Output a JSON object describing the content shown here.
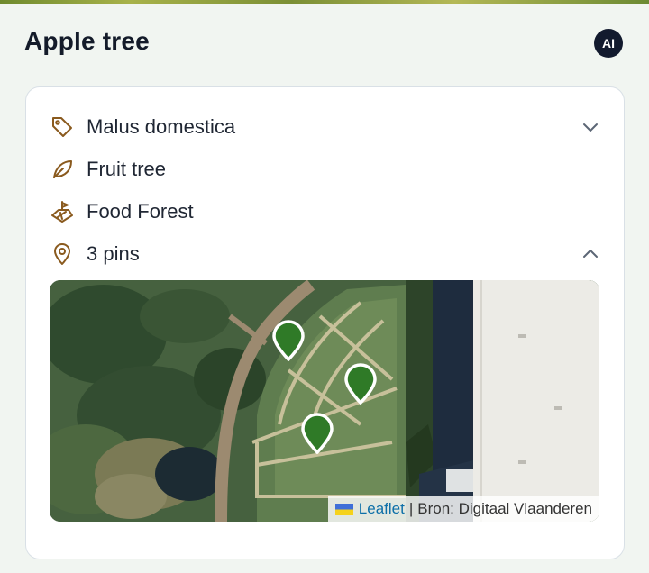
{
  "header": {
    "title": "Apple tree",
    "ai_badge": "AI"
  },
  "details": {
    "species": "Malus domestica",
    "type": "Fruit tree",
    "project": "Food Forest",
    "pins": "3 pins"
  },
  "map": {
    "attribution_link": "Leaflet",
    "attribution_separator": "|",
    "attribution_source": "Bron: Digitaal Vlaanderen",
    "pin_color": "#2f7a27"
  },
  "colors": {
    "accent_icon": "#8a5a1e",
    "chevron": "#5c6675"
  }
}
